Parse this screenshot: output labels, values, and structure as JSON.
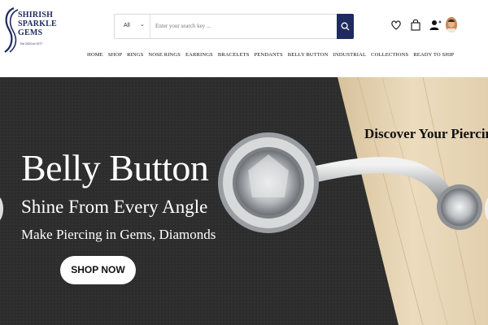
{
  "brand": {
    "name_line1": "SHIRISH",
    "name_line2": "SPARKLE",
    "name_line3": "GEMS",
    "tagline": "Est 2004 sd 1977"
  },
  "search": {
    "category": "All",
    "placeholder": "Enter your search key ..."
  },
  "header_icons": [
    "heart-icon",
    "shopping-bag-icon",
    "user-add-icon",
    "avatar"
  ],
  "nav": {
    "items": [
      "HOME",
      "SHOP",
      "RINGS",
      "NOSE RINGS",
      "EARRINGS",
      "BRACELETS",
      "PENDANTS",
      "BELLY BUTTON",
      "INDUSTRIAL",
      "COLLECTIONS",
      "READY TO SHIP"
    ]
  },
  "hero": {
    "title": "Belly Button",
    "subtitle": "Shine From Every Angle",
    "subtitle2": "Make Piercing in Gems, Diamonds",
    "cta": "SHOP NOW",
    "side_text": "Discover Your Piercing"
  },
  "colors": {
    "brand_navy": "#1f2a5e",
    "hero_dark": "#2b2b2b",
    "wood": "#e9d7b6"
  }
}
